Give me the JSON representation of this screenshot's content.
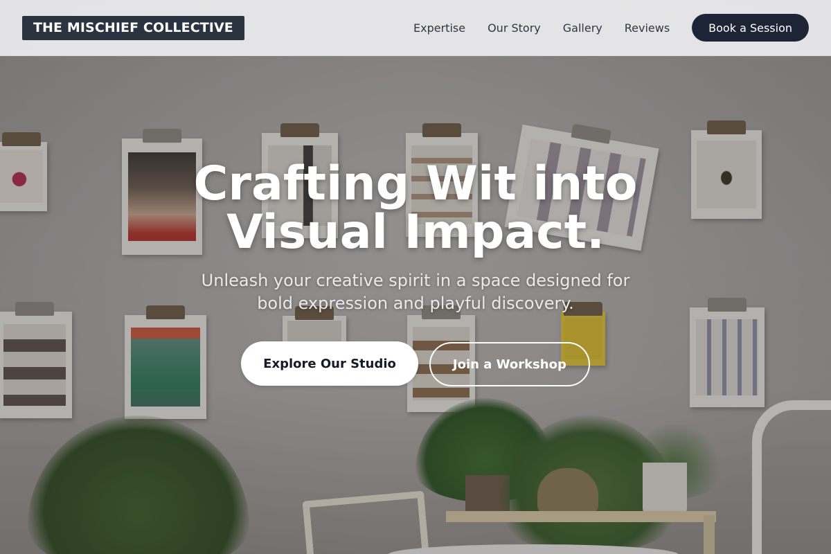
{
  "brand": {
    "name": "THE MISCHIEF COLLECTIVE"
  },
  "nav": {
    "items": [
      {
        "label": "Expertise"
      },
      {
        "label": "Our Story"
      },
      {
        "label": "Gallery"
      },
      {
        "label": "Reviews"
      }
    ],
    "cta_label": "Book a Session"
  },
  "hero": {
    "headline": "Crafting Wit into Visual Impact.",
    "subheadline": "Unleash your creative spirit in a space designed for bold expression and playful discovery.",
    "primary_button": "Explore Our Studio",
    "secondary_button": "Join a Workshop"
  },
  "colors": {
    "header_bg": "#ececee",
    "logo_bg": "#2b3240",
    "cta_bg": "#1c2435",
    "hero_text": "#ffffff"
  }
}
